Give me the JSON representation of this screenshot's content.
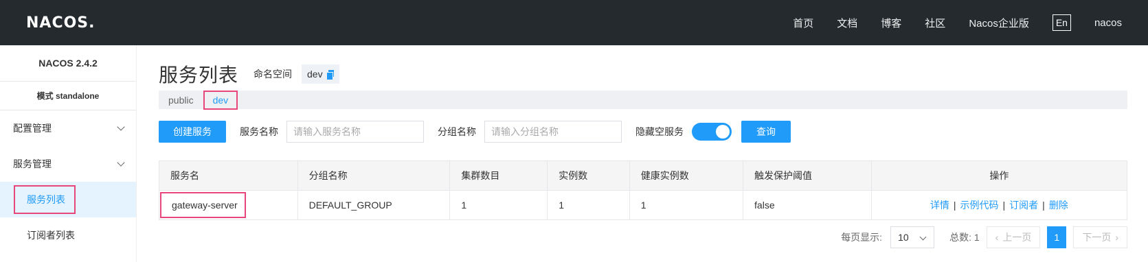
{
  "header": {
    "logo": "NACOS.",
    "nav": [
      "首页",
      "文档",
      "博客",
      "社区",
      "Nacos企业版"
    ],
    "lang": "En",
    "user": "nacos"
  },
  "sidebar": {
    "version": "NACOS 2.4.2",
    "mode": "模式 standalone",
    "groups": [
      {
        "label": "配置管理"
      },
      {
        "label": "服务管理"
      }
    ],
    "items": [
      {
        "label": "服务列表"
      },
      {
        "label": "订阅者列表"
      }
    ]
  },
  "main": {
    "title": "服务列表",
    "namespace_label": "命名空间",
    "namespace_value": "dev",
    "tabs": [
      "public",
      "dev"
    ],
    "create_button": "创建服务",
    "service_name_label": "服务名称",
    "service_name_placeholder": "请输入服务名称",
    "group_name_label": "分组名称",
    "group_name_placeholder": "请输入分组名称",
    "hide_empty_label": "隐藏空服务",
    "query_button": "查询",
    "columns": [
      "服务名",
      "分组名称",
      "集群数目",
      "实例数",
      "健康实例数",
      "触发保护阈值",
      "操作"
    ],
    "rows": [
      {
        "name": "gateway-server",
        "group": "DEFAULT_GROUP",
        "clusters": "1",
        "instances": "1",
        "healthy": "1",
        "threshold": "false",
        "ops": [
          "详情",
          "示例代码",
          "订阅者",
          "删除"
        ]
      }
    ],
    "pager": {
      "page_size_label": "每页显示:",
      "page_size": "10",
      "total": "总数: 1",
      "prev": "上一页",
      "current": "1",
      "next": "下一页"
    }
  },
  "colors": {
    "header_bg": "#252a2f",
    "primary": "#209bfa",
    "highlight_border": "#e8457a"
  }
}
